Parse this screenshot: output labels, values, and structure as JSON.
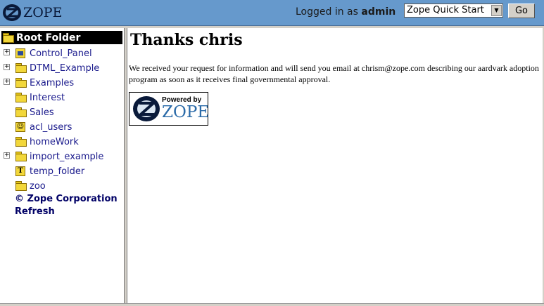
{
  "header": {
    "logo_text": "ZOPE",
    "logged_in_prefix": "Logged in as",
    "username": "admin",
    "quickstart_selected": "Zope Quick Start",
    "go_label": "Go"
  },
  "tree": {
    "root_label": "Root Folder",
    "items": [
      {
        "label": "Control_Panel",
        "expandable": true,
        "icon": "control-panel-icon"
      },
      {
        "label": "DTML_Example",
        "expandable": true,
        "icon": "folder-icon"
      },
      {
        "label": "Examples",
        "expandable": true,
        "icon": "folder-icon"
      },
      {
        "label": "Interest",
        "expandable": false,
        "icon": "folder-icon"
      },
      {
        "label": "Sales",
        "expandable": false,
        "icon": "folder-icon"
      },
      {
        "label": "acl_users",
        "expandable": false,
        "icon": "user-folder-icon"
      },
      {
        "label": "homeWork",
        "expandable": false,
        "icon": "folder-icon"
      },
      {
        "label": "import_example",
        "expandable": true,
        "icon": "folder-icon"
      },
      {
        "label": "temp_folder",
        "expandable": false,
        "icon": "temp-folder-icon"
      },
      {
        "label": "zoo",
        "expandable": false,
        "icon": "folder-icon"
      }
    ],
    "copyright_link": "© Zope Corporation",
    "refresh_link": "Refresh"
  },
  "main": {
    "heading": "Thanks chris",
    "message": "We received your request for information and will send you email at chrism@zope.com describing our aardvark adoption program as soon as it receives final governmental approval.",
    "badge_top": "Powered by",
    "badge_bottom": "ZOPE"
  }
}
